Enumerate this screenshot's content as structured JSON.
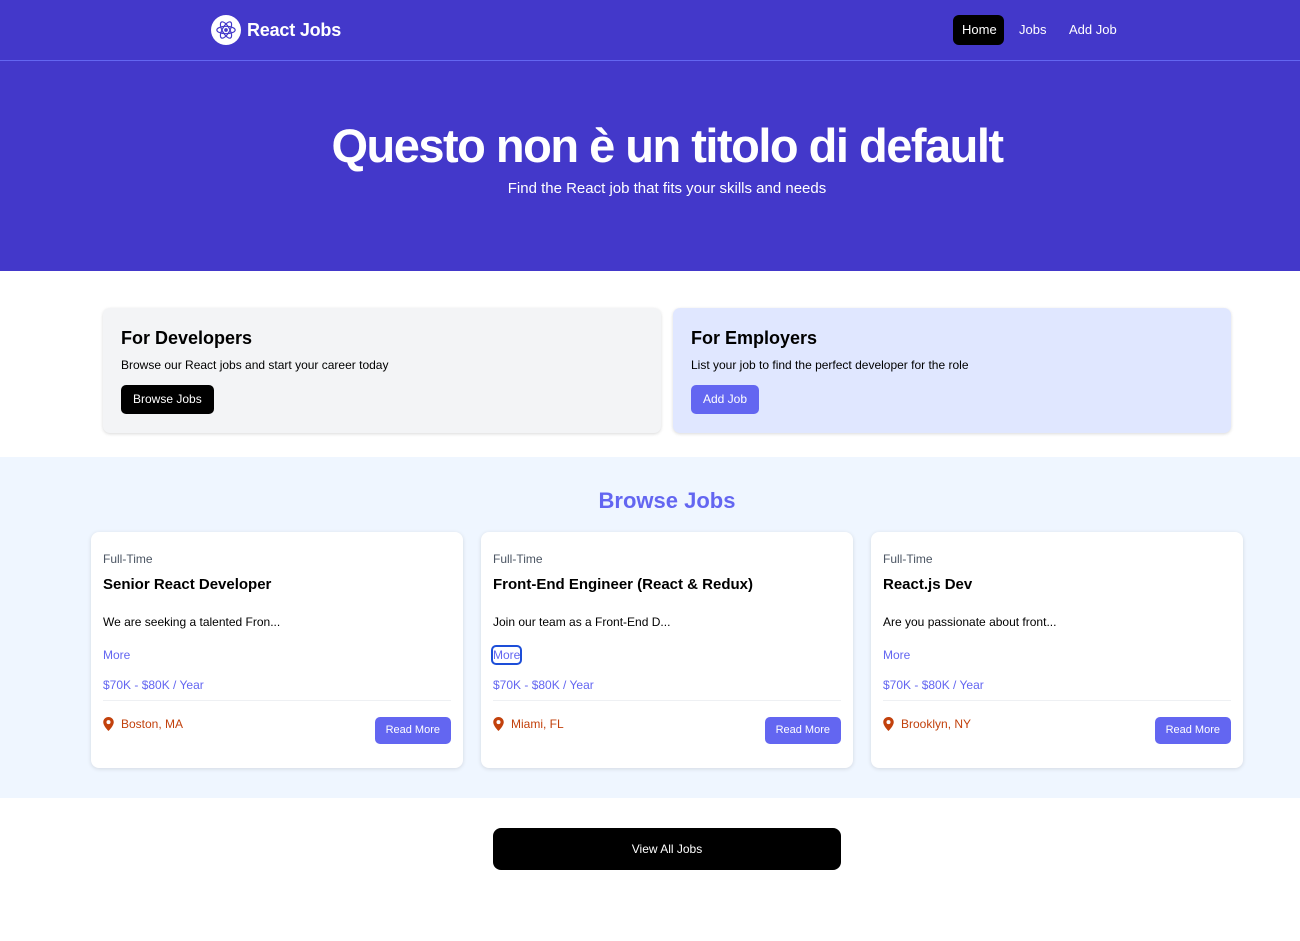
{
  "nav": {
    "brand": "React Jobs",
    "links": [
      {
        "label": "Home"
      },
      {
        "label": "Jobs"
      },
      {
        "label": "Add Job"
      }
    ],
    "icons": {
      "logo": "react-atom-icon"
    }
  },
  "hero": {
    "title": "Questo non è un titolo di default",
    "subtitle": "Find the React job that fits your skills and needs"
  },
  "panels": {
    "developers": {
      "title": "For Developers",
      "text": "Browse our React jobs and start your career today",
      "button": "Browse Jobs"
    },
    "employers": {
      "title": "For Employers",
      "text": "List your job to find the perfect developer for the role",
      "button": "Add Job"
    }
  },
  "browse": {
    "title": "Browse Jobs",
    "jobs": [
      {
        "type": "Full-Time",
        "title": "Senior React Developer",
        "description": "We are seeking a talented Fron...",
        "more": "More",
        "salary": "$70K - $80K / Year",
        "location": "Boston, MA",
        "button": "Read More"
      },
      {
        "type": "Full-Time",
        "title": "Front-End Engineer (React & Redux)",
        "description": "Join our team as a Front-End D...",
        "more": "More",
        "salary": "$70K - $80K / Year",
        "location": "Miami, FL",
        "button": "Read More"
      },
      {
        "type": "Full-Time",
        "title": "React.js Dev",
        "description": "Are you passionate about front...",
        "more": "More",
        "salary": "$70K - $80K / Year",
        "location": "Brooklyn, NY",
        "button": "Read More"
      }
    ]
  },
  "view_all": "View All Jobs",
  "colors": {
    "primary": "#4338ca",
    "accent": "#6366f1",
    "location": "#c2410c",
    "browse_bg": "#eff6ff",
    "employer_bg": "#e0e7ff"
  }
}
